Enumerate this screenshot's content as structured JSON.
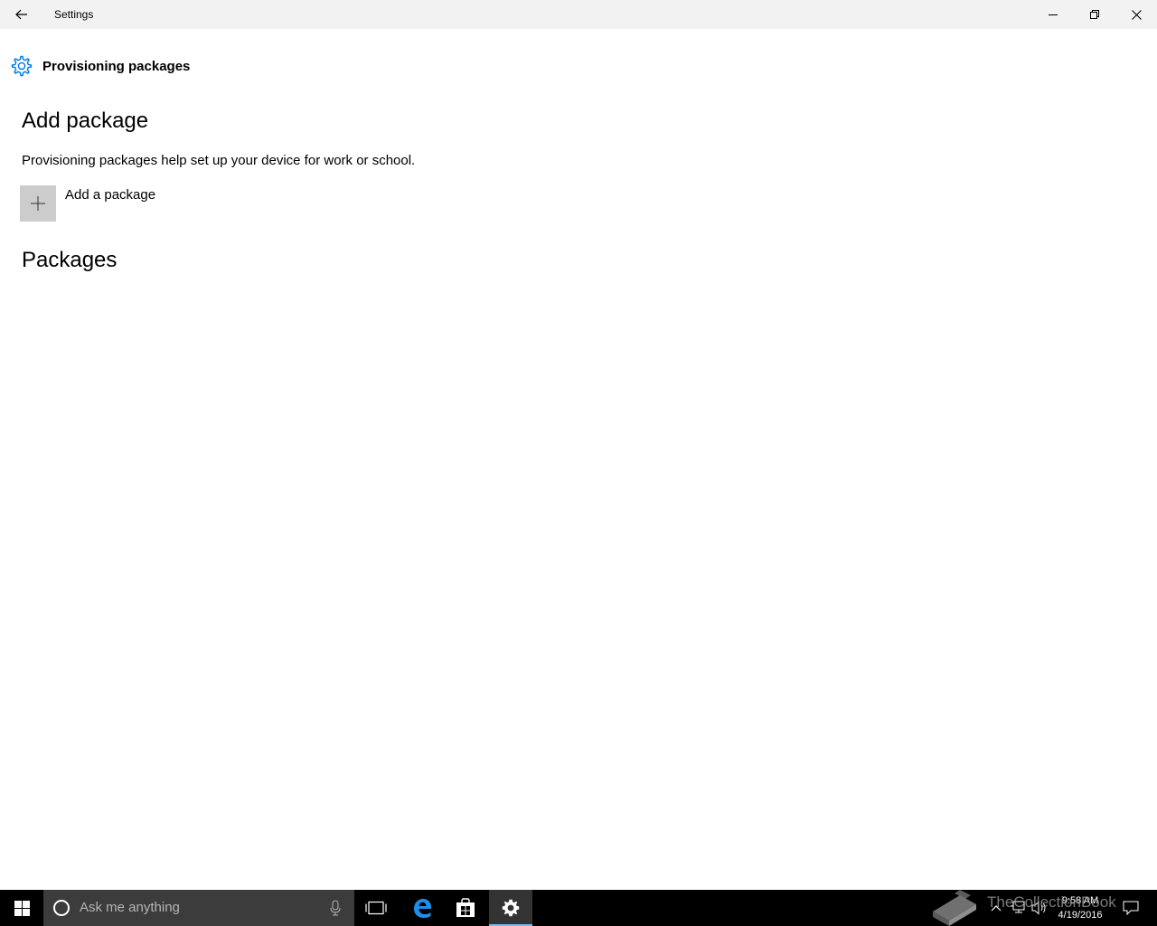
{
  "window": {
    "title": "Settings",
    "controls": {
      "minimize": "minimize",
      "maximize": "restore",
      "close": "close"
    }
  },
  "page": {
    "title": "Provisioning packages",
    "icon": "gear-icon",
    "accent": "#0078d7"
  },
  "add_section": {
    "heading": "Add package",
    "description": "Provisioning packages help set up your device for work or school.",
    "add_button_label": "Add a package"
  },
  "packages_section": {
    "heading": "Packages"
  },
  "taskbar": {
    "search_placeholder": "Ask me anything",
    "pinned": [
      "task-view-icon",
      "edge-icon",
      "store-icon",
      "settings-icon"
    ],
    "active": "settings-icon",
    "clock": {
      "time": "9:58 AM",
      "date": "4/19/2016"
    }
  },
  "watermark": {
    "text": "TheCollectionBook"
  }
}
